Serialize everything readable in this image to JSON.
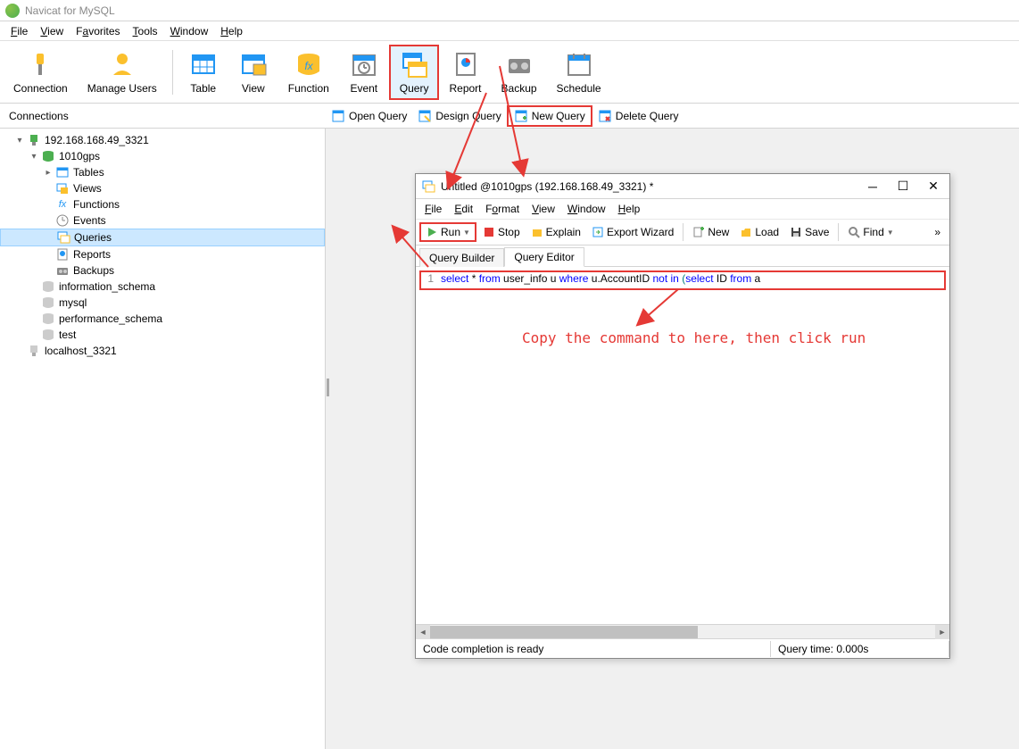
{
  "app_title": "Navicat for MySQL",
  "main_menu": [
    "File",
    "View",
    "Favorites",
    "Tools",
    "Window",
    "Help"
  ],
  "main_toolbar": {
    "connection": "Connection",
    "manage_users": "Manage Users",
    "table": "Table",
    "view": "View",
    "function": "Function",
    "event": "Event",
    "query": "Query",
    "report": "Report",
    "backup": "Backup",
    "schedule": "Schedule"
  },
  "sub_toolbar": {
    "connections_label": "Connections",
    "open_query": "Open Query",
    "design_query": "Design Query",
    "new_query": "New Query",
    "delete_query": "Delete Query"
  },
  "tree": {
    "server1": "192.168.168.49_3321",
    "db_1010gps": "1010gps",
    "tables": "Tables",
    "views": "Views",
    "functions": "Functions",
    "events": "Events",
    "queries": "Queries",
    "reports": "Reports",
    "backups": "Backups",
    "db_information_schema": "information_schema",
    "db_mysql": "mysql",
    "db_performance_schema": "performance_schema",
    "db_test": "test",
    "server2": "localhost_3321"
  },
  "query_window": {
    "title": "Untitled @1010gps (192.168.168.49_3321) *",
    "menu": [
      "File",
      "Edit",
      "Format",
      "View",
      "Window",
      "Help"
    ],
    "toolbar": {
      "run": "Run",
      "stop": "Stop",
      "explain": "Explain",
      "export_wizard": "Export Wizard",
      "new": "New",
      "load": "Load",
      "save": "Save",
      "find": "Find"
    },
    "tabs": {
      "query_builder": "Query Builder",
      "query_editor": "Query Editor"
    },
    "sql": {
      "line_number": "1",
      "tokens": [
        {
          "t": "select",
          "c": "kw"
        },
        {
          "t": " * ",
          "c": "id"
        },
        {
          "t": "from",
          "c": "kw"
        },
        {
          "t": " user_info u ",
          "c": "id"
        },
        {
          "t": "where",
          "c": "kw"
        },
        {
          "t": " u.AccountID ",
          "c": "id"
        },
        {
          "t": "not in ",
          "c": "kw"
        },
        {
          "t": "(",
          "c": "paren"
        },
        {
          "t": "select",
          "c": "kw"
        },
        {
          "t": " ID ",
          "c": "id"
        },
        {
          "t": "from",
          "c": "kw"
        },
        {
          "t": " a",
          "c": "id"
        }
      ]
    },
    "status": {
      "completion": "Code completion is ready",
      "query_time": "Query time: 0.000s"
    }
  },
  "annotation": "Copy the command to here, then click run"
}
